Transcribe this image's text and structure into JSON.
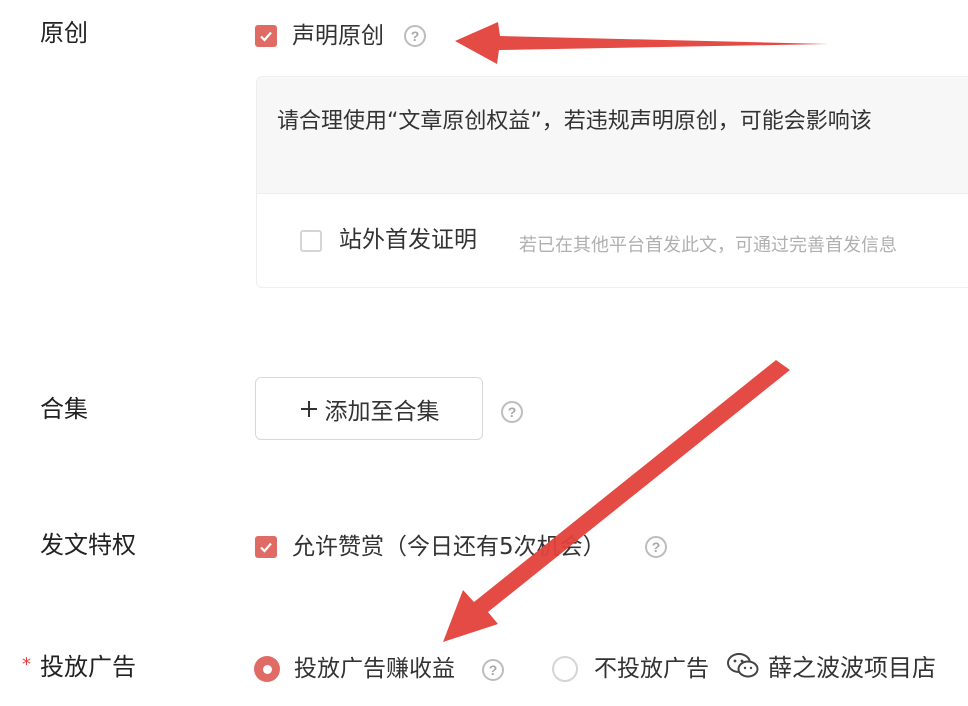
{
  "original": {
    "label": "原创",
    "declare_label": "声明原创",
    "declare_checked": true,
    "notice": "请合理使用“文章原创权益”，若违规声明原创，可能会影响该",
    "first_publish_label": "站外首发证明",
    "first_publish_checked": false,
    "first_publish_hint": "若已在其他平台首发此文，可通过完善首发信息"
  },
  "collection": {
    "label": "合集",
    "add_button": "添加至合集",
    "add_icon": "plus-icon"
  },
  "privilege": {
    "label": "发文特权",
    "reward_label": "允许赞赏（今日还有5次机会）",
    "reward_checked": true
  },
  "ads": {
    "required_mark": "*",
    "label": "投放广告",
    "options": [
      {
        "label": "投放广告赚收益",
        "selected": true
      },
      {
        "label": "不投放广告",
        "selected": false
      }
    ]
  },
  "watermark": {
    "text": "薛之波波项目店",
    "icon": "wechat-icon"
  },
  "colors": {
    "accent": "#e06a64",
    "arrow": "#e3413a"
  }
}
